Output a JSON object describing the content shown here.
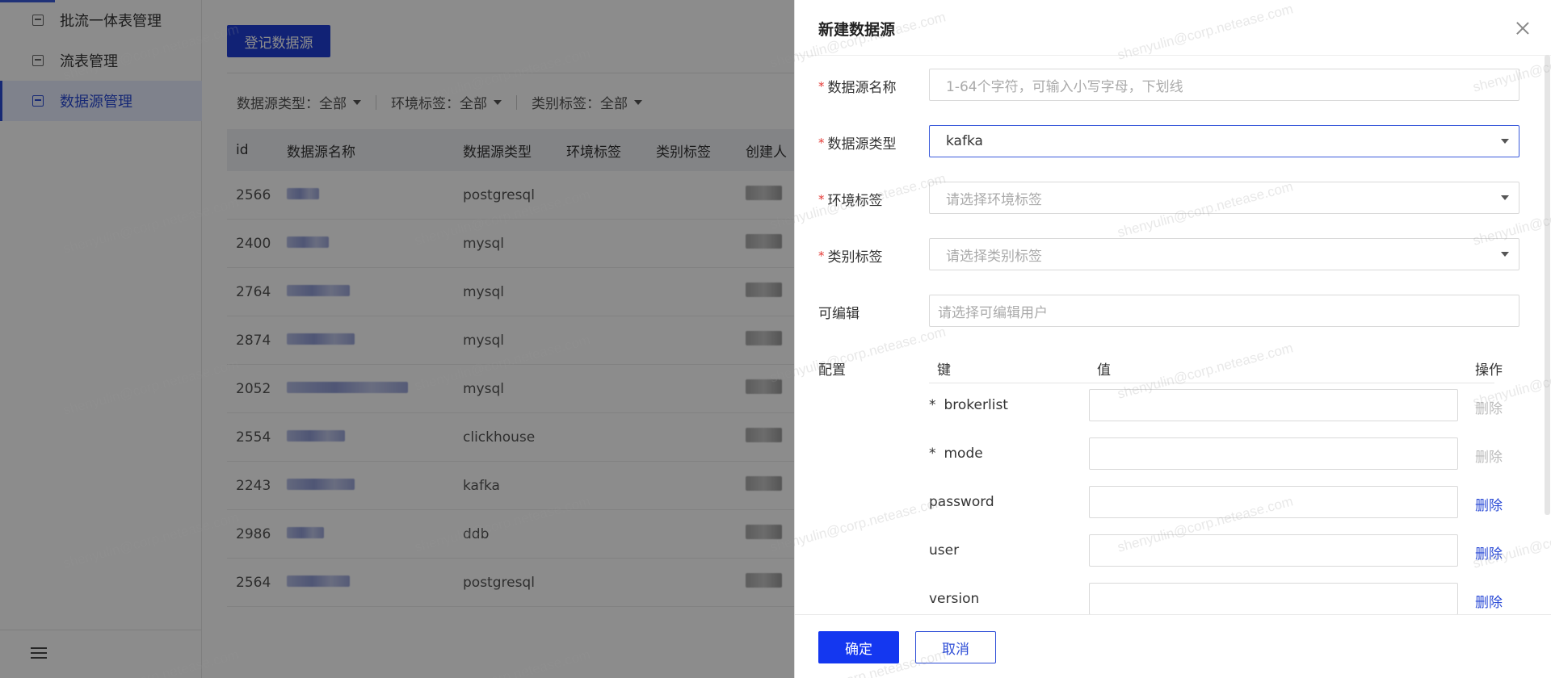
{
  "sidebar": {
    "items": [
      {
        "label": "批流一体表管理",
        "icon": "table-icon"
      },
      {
        "label": "流表管理",
        "icon": "table-icon"
      },
      {
        "label": "数据源管理",
        "icon": "clipboard-icon"
      }
    ],
    "active_index": 2
  },
  "main": {
    "register_button": "登记数据源",
    "filters": [
      {
        "label": "数据源类型：全部"
      },
      {
        "label": "环境标签：全部"
      },
      {
        "label": "类别标签：全部"
      }
    ],
    "table": {
      "columns": [
        "id",
        "数据源名称",
        "数据源类型",
        "环境标签",
        "类别标签",
        "创建人"
      ],
      "rows": [
        {
          "id": "2566",
          "type": "postgresql"
        },
        {
          "id": "2400",
          "type": "mysql"
        },
        {
          "id": "2764",
          "type": "mysql"
        },
        {
          "id": "2874",
          "type": "mysql"
        },
        {
          "id": "2052",
          "type": "mysql"
        },
        {
          "id": "2554",
          "type": "clickhouse"
        },
        {
          "id": "2243",
          "type": "kafka"
        },
        {
          "id": "2986",
          "type": "ddb"
        },
        {
          "id": "2564",
          "type": "postgresql"
        }
      ]
    }
  },
  "drawer": {
    "title": "新建数据源",
    "fields": {
      "name": {
        "label": "数据源名称",
        "placeholder": "1-64个字符，可输入小写字母，下划线",
        "required": true
      },
      "type": {
        "label": "数据源类型",
        "value": "kafka",
        "required": true
      },
      "env": {
        "label": "环境标签",
        "placeholder": "请选择环境标签",
        "required": true
      },
      "category": {
        "label": "类别标签",
        "placeholder": "请选择类别标签",
        "required": true
      },
      "editors": {
        "label": "可编辑",
        "placeholder": "请选择可编辑用户",
        "required": false
      }
    },
    "config": {
      "label": "配置",
      "col_key": "键",
      "col_value": "值",
      "col_action": "操作",
      "rows": [
        {
          "key": "brokerlist",
          "required": true,
          "value": "",
          "action": "删除",
          "action_enabled": false
        },
        {
          "key": "mode",
          "required": true,
          "value": "",
          "action": "删除",
          "action_enabled": false
        },
        {
          "key": "password",
          "required": false,
          "value": "",
          "action": "删除",
          "action_enabled": true
        },
        {
          "key": "user",
          "required": false,
          "value": "",
          "action": "删除",
          "action_enabled": true
        },
        {
          "key": "version",
          "required": false,
          "value": "",
          "action": "删除",
          "action_enabled": true
        }
      ]
    },
    "confirm_button": "确定",
    "cancel_button": "取消"
  },
  "watermark": "shenyulin@corp.netease.com",
  "colors": {
    "primary": "#1437f0",
    "accent": "#2b4bd6",
    "required": "#e53935"
  }
}
